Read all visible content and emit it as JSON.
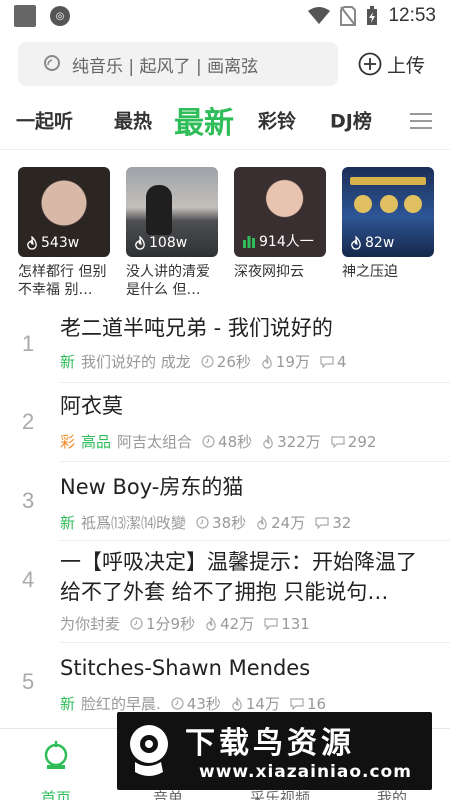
{
  "status_bar": {
    "time": "12:53"
  },
  "search": {
    "placeholder": "纯音乐 | 起风了 | 画离弦",
    "upload_label": "上传"
  },
  "tabs": [
    {
      "label": "一起听"
    },
    {
      "label": "最热"
    },
    {
      "label": "最新",
      "active": true
    },
    {
      "label": "彩铃"
    },
    {
      "label": "DJ榜"
    }
  ],
  "cards": [
    {
      "count": "543w",
      "title": "怎样都行 但别不幸福 别…",
      "icon": "flame-icon",
      "thumb_color": "#3a3a3a"
    },
    {
      "count": "108w",
      "title": "没人讲的清爱是什么 但…",
      "icon": "flame-icon",
      "thumb_color": "#7a7f86"
    },
    {
      "count": "914人一",
      "title": "深夜网抑云",
      "icon": "live-bars-icon",
      "thumb_color": "#4a3b3b"
    },
    {
      "count": "82w",
      "title": "神之压迫",
      "icon": "flame-icon",
      "thumb_color": "#1f3a6a"
    }
  ],
  "songs": [
    {
      "rank": "1",
      "title": "老二道半吨兄弟 - 我们说好的",
      "tag": "新",
      "tag2": "",
      "artist": "我们说好的 成龙",
      "duration": "26秒",
      "plays": "19万",
      "comments": "4"
    },
    {
      "rank": "2",
      "title": "阿衣莫",
      "tag": "彩",
      "tag2": "高品",
      "artist": "阿吉太组合",
      "duration": "48秒",
      "plays": "322万",
      "comments": "292"
    },
    {
      "rank": "3",
      "title": "New Boy-房东的猫",
      "tag": "新",
      "tag2": "",
      "artist": "祗爲⒀潔⒁攺變",
      "duration": "38秒",
      "plays": "24万",
      "comments": "32"
    },
    {
      "rank": "4",
      "title": "一【呼吸决定】温馨提示：开始降温了 给不了外套 给不了拥抱 只能说句…",
      "tag": "",
      "tag2": "",
      "artist": "为你封麦",
      "duration": "1分9秒",
      "plays": "42万",
      "comments": "131"
    },
    {
      "rank": "5",
      "title": "Stitches-Shawn Mendes",
      "tag": "新",
      "tag2": "",
      "artist": "脸红的早晨.",
      "duration": "43秒",
      "plays": "14万",
      "comments": "16"
    }
  ],
  "bottom_nav": [
    {
      "label": "首页",
      "active": true
    },
    {
      "label": "音单"
    },
    {
      "label": "采乐视频"
    },
    {
      "label": "我的"
    }
  ],
  "watermark": {
    "title": "下载鸟资源",
    "url": "www.xiazainiao.com"
  },
  "colors": {
    "accent": "#2ebd59",
    "tag_orange": "#f08a24"
  }
}
